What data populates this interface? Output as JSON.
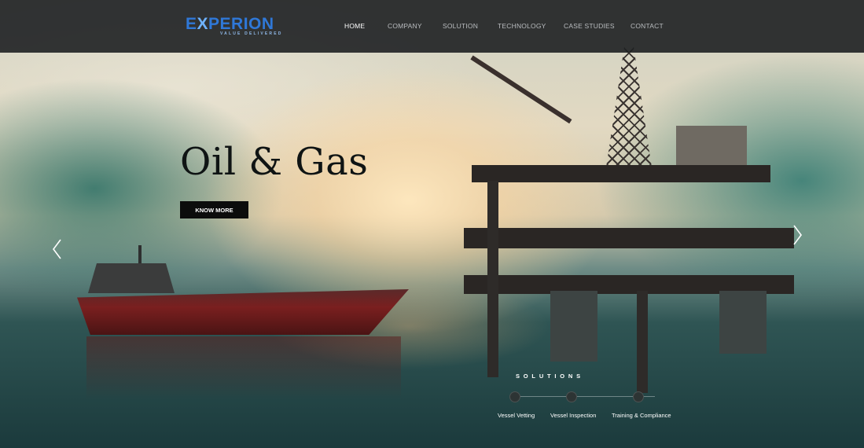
{
  "brand": {
    "logo_prefix": "E",
    "logo_x": "X",
    "logo_rest": "PERION",
    "tagline": "VALUE DELIVERED"
  },
  "nav": {
    "items": [
      {
        "label": "HOME",
        "active": true
      },
      {
        "label": "COMPANY",
        "active": false
      },
      {
        "label": "SOLUTION",
        "active": false
      },
      {
        "label": "TECHNOLOGY",
        "active": false
      },
      {
        "label": "CASE STUDIES",
        "active": false
      },
      {
        "label": "CONTACT",
        "active": false
      }
    ]
  },
  "hero": {
    "title": "Oil & Gas",
    "cta_label": "KNOW MORE"
  },
  "solutions": {
    "heading": "SOLUTIONS",
    "items": [
      "Vessel Vetting",
      "Vessel Inspection",
      "Training & Compliance"
    ]
  },
  "icons": {
    "prev": "chevron-left-icon",
    "next": "chevron-right-icon"
  },
  "colors": {
    "navbar": "#1e2022",
    "logo": "#2f78d8",
    "cta_bg": "#0c0c0c",
    "text_light": "#ffffff"
  }
}
